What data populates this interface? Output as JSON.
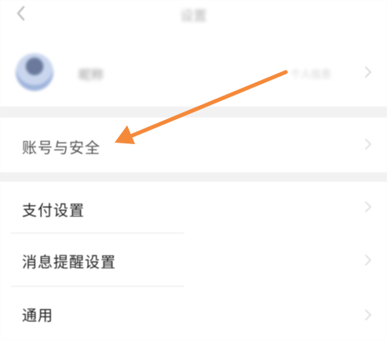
{
  "header": {
    "title": "设置",
    "back_icon": "chevron-left-icon"
  },
  "profile": {
    "name": "昵称",
    "meta": "个人信息",
    "chevron_icon": "chevron-right-icon"
  },
  "settings": {
    "account_security": "账号与安全",
    "payment_settings": "支付设置",
    "notification_settings": "消息提醒设置",
    "general": "通用"
  },
  "annotation": {
    "arrow_color": "#f5893a",
    "arrow_icon": "annotation-arrow-icon"
  },
  "colors": {
    "background": "#f2f2f2",
    "row_background": "#ffffff",
    "text": "#222222",
    "chevron": "#d0d0d0"
  }
}
